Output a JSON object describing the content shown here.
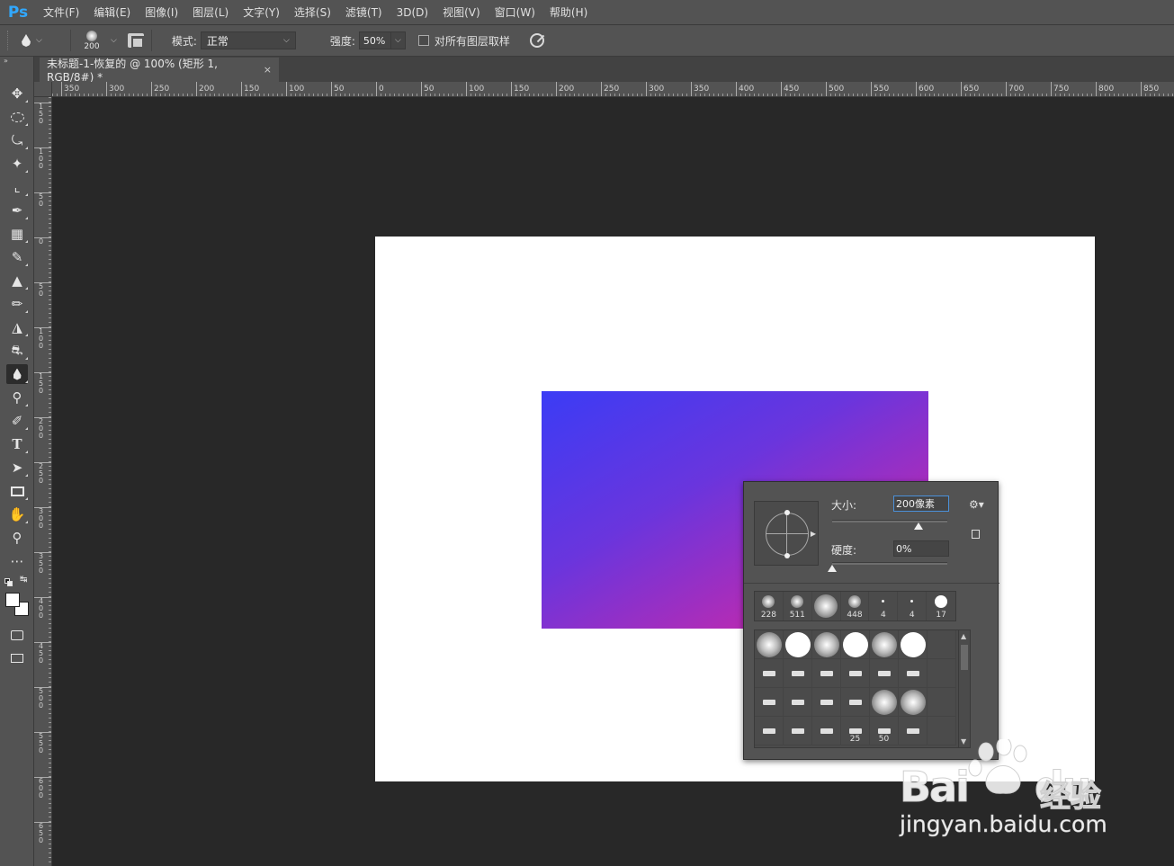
{
  "app": {
    "logo": "Ps"
  },
  "menu": [
    "文件(F)",
    "编辑(E)",
    "图像(I)",
    "图层(L)",
    "文字(Y)",
    "选择(S)",
    "滤镜(T)",
    "3D(D)",
    "视图(V)",
    "窗口(W)",
    "帮助(H)"
  ],
  "options": {
    "tool_icon": "blur-drop-icon",
    "brush_size": "200",
    "mode_label": "模式:",
    "mode_value": "正常",
    "strength_label": "强度:",
    "strength_value": "50%",
    "sample_all_label": "对所有图层取样",
    "sample_all_checked": false
  },
  "document_tab": {
    "title": "未标题-1-恢复的 @ 100% (矩形 1, RGB/8#) *",
    "close": "×"
  },
  "ruler_h": [
    "350",
    "300",
    "250",
    "200",
    "150",
    "100",
    "50",
    "0",
    "50",
    "100",
    "150",
    "200",
    "250",
    "300",
    "350",
    "400",
    "450",
    "500",
    "550",
    "600",
    "650",
    "700",
    "750",
    "800",
    "850"
  ],
  "ruler_v": [
    "150",
    "100",
    "50",
    "0",
    "50",
    "100",
    "150",
    "200",
    "250",
    "300",
    "350",
    "400",
    "450",
    "500",
    "550",
    "600",
    "650"
  ],
  "tools": [
    "move-icon",
    "marquee-icon",
    "lasso-icon",
    "magic-wand-icon",
    "crop-icon",
    "eyedropper-icon",
    "healing-brush-icon",
    "brush-icon",
    "clone-stamp-icon",
    "history-brush-icon",
    "eraser-icon",
    "paint-bucket-icon",
    "blur-icon",
    "dodge-icon",
    "pen-icon",
    "type-icon",
    "path-select-icon",
    "rectangle-icon",
    "hand-icon",
    "zoom-icon",
    "more-tools-icon"
  ],
  "colors": {
    "foreground": "#ffffff",
    "background": "#ffffff",
    "gradient_start": "#3b3cf5",
    "gradient_end": "#d023a0",
    "accent": "#31a8ff"
  },
  "brush_popup": {
    "size_label": "大小:",
    "size_value": "200像素",
    "size_fraction": 0.75,
    "hardness_label": "硬度:",
    "hardness_value": "0%",
    "hardness_fraction": 0.0,
    "recent": [
      "228",
      "511",
      "",
      "448",
      "4",
      "4",
      "17"
    ],
    "grid_labels": [
      "25",
      "50"
    ]
  },
  "watermark": {
    "brand": "Bai",
    "brand_tail": "du",
    "product": "经验",
    "url": "jingyan.baidu.com"
  }
}
